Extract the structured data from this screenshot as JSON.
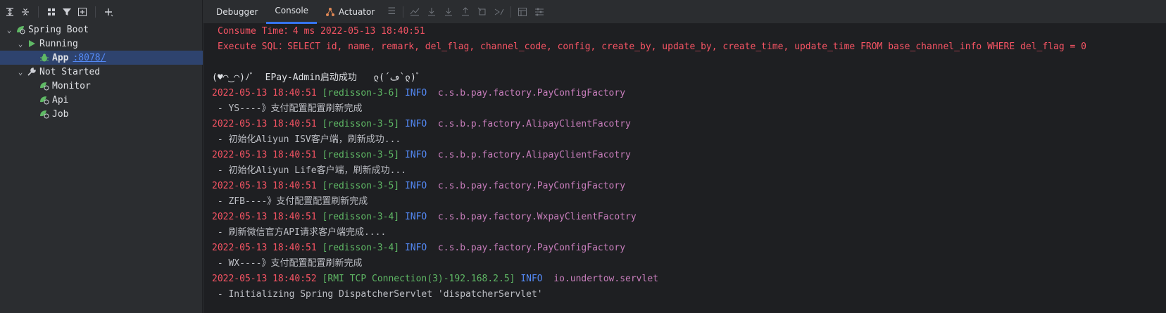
{
  "left_panel": {
    "toolbar": [
      "expand-all-icon",
      "collapse-all-icon",
      "group-icon",
      "filter-icon",
      "new-tab-icon",
      "add-icon"
    ],
    "tree": [
      {
        "label": "Spring Boot",
        "level": 0,
        "expanded": true,
        "icon": "spring-boot-icon"
      },
      {
        "label": "Running",
        "level": 1,
        "expanded": true,
        "icon": "run-icon"
      },
      {
        "label": "App",
        "port": ":8078/",
        "level": 2,
        "selected": true,
        "icon": "debug-bug-icon"
      },
      {
        "label": "Not Started",
        "level": 1,
        "expanded": true,
        "icon": "wrench-icon"
      },
      {
        "label": "Monitor",
        "level": 2,
        "icon": "spring-app-icon"
      },
      {
        "label": "Api",
        "level": 2,
        "icon": "spring-app-icon"
      },
      {
        "label": "Job",
        "level": 2,
        "icon": "spring-app-icon"
      }
    ]
  },
  "tabs": [
    {
      "label": "Debugger",
      "active": false
    },
    {
      "label": "Console",
      "active": true
    },
    {
      "label": "Actuator",
      "active": false,
      "icon": "actuator-icon"
    }
  ],
  "console": {
    "consume_time": "Consume Time：4 ms 2022-05-13 18:40:51",
    "execute_sql": "Execute SQL：SELECT id, name, remark, del_flag, channel_code, config, create_by, update_by, create_time, update_time FROM base_channel_info WHERE del_flag = 0",
    "banner": "(♥◠‿◠)ﾉﾞ  EPay-Admin启动成功   ლ(´ڡ`ლ)ﾞ",
    "logs": [
      {
        "time": "2022-05-13 18:40:51",
        "thread": "[redisson-3-6]",
        "level": "INFO",
        "logger": "c.s.b.pay.factory.PayConfigFactory",
        "message": " - YS----》支付配置配置刷新完成"
      },
      {
        "time": "2022-05-13 18:40:51",
        "thread": "[redisson-3-5]",
        "level": "INFO",
        "logger": "c.s.b.p.factory.AlipayClientFacotry",
        "message": " - 初始化Aliyun ISV客户端，刷新成功..."
      },
      {
        "time": "2022-05-13 18:40:51",
        "thread": "[redisson-3-5]",
        "level": "INFO",
        "logger": "c.s.b.p.factory.AlipayClientFacotry",
        "message": " - 初始化Aliyun Life客户端，刷新成功..."
      },
      {
        "time": "2022-05-13 18:40:51",
        "thread": "[redisson-3-5]",
        "level": "INFO",
        "logger": "c.s.b.pay.factory.PayConfigFactory",
        "message": " - ZFB----》支付配置配置刷新完成"
      },
      {
        "time": "2022-05-13 18:40:51",
        "thread": "[redisson-3-4]",
        "level": "INFO",
        "logger": "c.s.b.pay.factory.WxpayClientFacotry",
        "message": " - 刷新微信官方API请求客户端完成...."
      },
      {
        "time": "2022-05-13 18:40:51",
        "thread": "[redisson-3-4]",
        "level": "INFO",
        "logger": "c.s.b.pay.factory.PayConfigFactory",
        "message": " - WX----》支付配置配置刷新完成"
      },
      {
        "time": "2022-05-13 18:40:52",
        "thread": "[RMI TCP Connection(3)-192.168.2.5]",
        "level": "INFO",
        "logger": "io.undertow.servlet",
        "message": " - Initializing Spring DispatcherServlet 'dispatcherServlet'"
      }
    ]
  },
  "colors": {
    "error_red": "#f75464",
    "thread_green": "#5fb865",
    "info_blue": "#548af7",
    "logger_purple": "#c77dbb",
    "tab_accent": "#3574f0"
  }
}
